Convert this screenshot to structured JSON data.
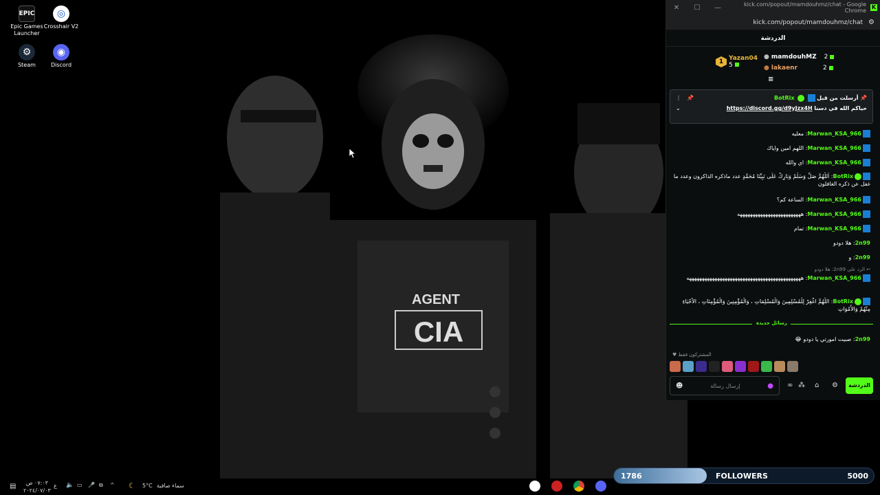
{
  "desktop": {
    "icons": [
      {
        "label": "Epic Games Launcher",
        "glyph": "EPIC"
      },
      {
        "label": "Crosshair V2",
        "glyph": "◎"
      },
      {
        "label": "Steam",
        "glyph": "⚙"
      },
      {
        "label": "Discord",
        "glyph": "◉"
      }
    ],
    "wallpaper": {
      "agent_text": "AGENT",
      "cia_text": "CIA"
    }
  },
  "browser": {
    "title": "kick.com/popout/mamdouhmz/chat - Google Chrome",
    "url": "kick.com/popout/mamdouhmz/chat"
  },
  "chat": {
    "header": "الدردشة",
    "leaderboard": [
      {
        "name": "Yazan04",
        "count": "5",
        "rank": "1"
      },
      {
        "name": "mamdouhMZ",
        "count": "2"
      },
      {
        "name": "lakaenr",
        "count": "2"
      }
    ],
    "pinned": {
      "meta": "أرسلت من قبل",
      "user": "BotRix",
      "text": "حياكم الله في دسنا",
      "link": "https://discord.gg/d9yJzx4H"
    },
    "messages": [
      {
        "user": "Marwan_KSA_966",
        "text": "معليه"
      },
      {
        "user": "Marwan_KSA_966",
        "text": "اللهم امين واياك"
      },
      {
        "user": "Marwan_KSA_966",
        "text": "اي والله"
      },
      {
        "user": "BotRix",
        "text": "اَللَّهُمَّ صَلِّ وَسَلِّمْ وَبَارِكْ عَلَى نَبِيِّنَا مُحَمَّدٍ عدد ماذكره الذاكرون وعدد ما غفل عن ذكره الغافلون"
      },
      {
        "user": "Marwan_KSA_966",
        "text": "الساعة كم؟"
      },
      {
        "user": "Marwan_KSA_966",
        "text": "هههههههههههههههههههههههههه"
      },
      {
        "user": "Marwan_KSA_966",
        "text": "تمام"
      },
      {
        "user": "2n99",
        "text": "هلا دودو"
      },
      {
        "user": "2n99",
        "text": "و"
      },
      {
        "user": "Marwan_KSA_966",
        "text": "هههههههههههههههههههههههههههههههههههههههههههههه",
        "reply": "الرد على 2n99: هلا دودو"
      },
      {
        "user": "BotRix",
        "text": "اللَّهُمَّ اغْفِرْ لِلْمُسْلِمِينَ وَالْمُسْلِمَاتِ ، وَالْمُؤْمِنِينَ وَالْمُؤْمِنَاتِ ، الأَحْيَاءِ مِنْهُمْ وَالأَمْوَاتِ"
      },
      {
        "user": "2n99",
        "text": "صبيت امورتي يا دودو 😂"
      }
    ],
    "new_messages_label": "رسائل جديدة",
    "subscribers_only": "المشتركون فقط",
    "input_placeholder": "إرسال رسالة",
    "send_label": "الدردشة"
  },
  "taskbar": {
    "weather_temp": "5°C",
    "weather_text": "سماء صافية",
    "time": "٠٧:٠٣ ص",
    "date": "٢٠٢٤/٠٧/٠٣",
    "lang": "ع"
  },
  "followers_widget": {
    "current": "1786",
    "label": "FOLLOWERS",
    "goal": "5000",
    "progress": 0.357
  }
}
